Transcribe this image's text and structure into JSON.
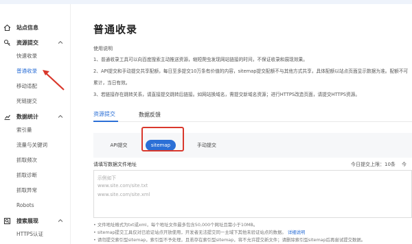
{
  "sidebar": {
    "groups": [
      {
        "label": "站点信息",
        "icon": "home-icon",
        "items": []
      },
      {
        "label": "资源提交",
        "icon": "link-icon",
        "items": [
          "快速收录",
          "普通收录",
          "移动适配",
          "死链提交"
        ]
      },
      {
        "label": "数据统计",
        "icon": "chart-icon",
        "items": [
          "索引量",
          "流量与关键词",
          "抓取频次",
          "抓取诊断",
          "抓取异常",
          "Robots"
        ]
      },
      {
        "label": "搜索展现",
        "icon": "search-display-icon",
        "items": [
          "HTTPS认证"
        ]
      }
    ],
    "active_item": "普通收录"
  },
  "main": {
    "title": "普通收录",
    "usage_head": "使用说明",
    "usage_lines": [
      "1、普通收录工具可以向百度搜索主动推送资源，缩短爬虫发现网站链接的时间，不保证收录和展现效果。",
      "2、API提交和手动提交共享配额，每日至多提交10万条有价值的内容，sitemap提交配额不与其他方式共享，具体配额以站点页面显示数据为准。配额不可",
      "累计，当日有效。",
      "3、若链接存在跳转关系，请直接提交跳转后链接。如网站换域名，需提交新域名资源；进行HTTPS改造页面，请提交HTTPS资源。"
    ],
    "tabs": [
      "资源提交",
      "数据反馈"
    ],
    "active_tab": "资源提交",
    "subtabs": [
      "API提交",
      "sitemap",
      "手动提交"
    ],
    "active_subtab": "sitemap",
    "field_label": "请填写数据文件地址",
    "limit_text": "今日提交上限：10条",
    "limit_text2": "今",
    "textarea_placeholder": [
      "示例如下",
      "www.site.com/site.txt",
      "www.site.com/site.xml"
    ],
    "notes": [
      "文件地址格式为txt或xml，每个地址文件最多包含50,000个网址且需小于10MB。",
      "sitemap提交工具仅对已验证站点开放使用，开发者无法提交同一主域下其他未验证站点的数据。",
      "请勿提交索引型sitemap，索引型不予处理，且若存在索引型sitemap，将不允许提交新文件；请删除索引型sitemap后再尝试提交数据。"
    ],
    "notes_link": "详细说明"
  },
  "colors": {
    "accent": "#2b6fd6",
    "highlight": "#d9372b"
  }
}
